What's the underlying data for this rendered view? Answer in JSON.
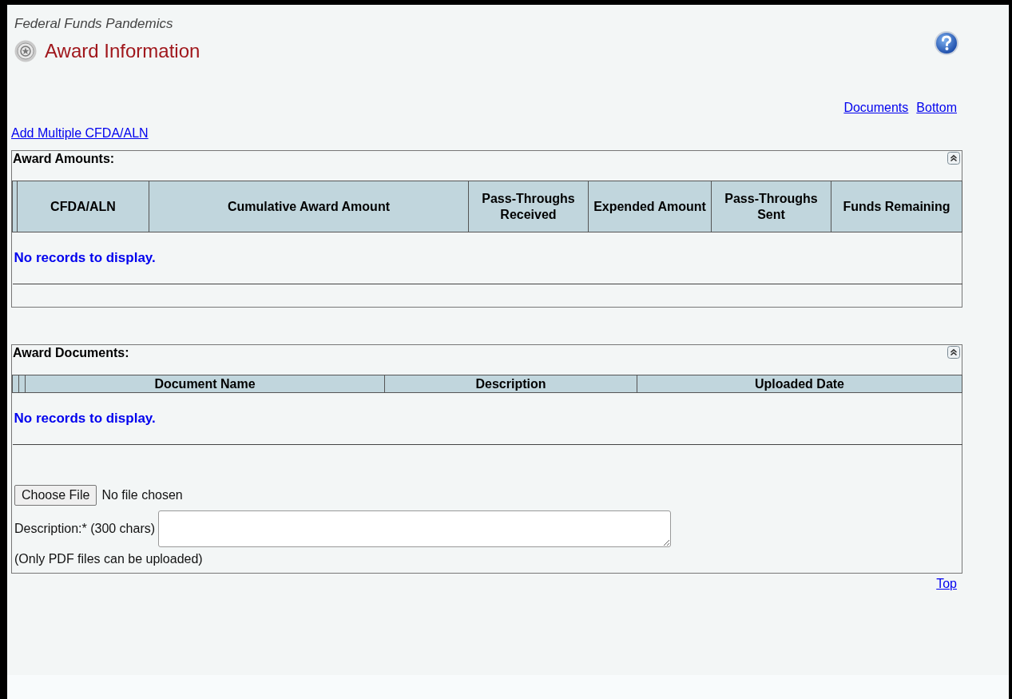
{
  "app_name": "Federal Funds Pandemics",
  "page_title": "Award Information",
  "nav_links": [
    "Documents",
    "Bottom"
  ],
  "add_link": "Add Multiple CFDA/ALN",
  "sections": [
    {
      "kind": "amounts",
      "title": "Award Amounts:",
      "columns": [
        "CFDA/ALN",
        "Cumulative Award Amount",
        "Pass-Throughs Received",
        "Expended Amount",
        "Pass-Throughs Sent",
        "Funds Remaining"
      ],
      "empty_message": "No records to display."
    },
    {
      "kind": "documents",
      "title": "Award Documents:",
      "columns": [
        "Document Name",
        "Description",
        "Uploaded Date"
      ],
      "empty_message": "No records to display.",
      "upload": {
        "button": "Choose File",
        "status": "No file chosen",
        "description_label": "Description:* (300 chars)",
        "note": "(Only PDF files can be uploaded)"
      }
    }
  ],
  "top_link": "Top"
}
